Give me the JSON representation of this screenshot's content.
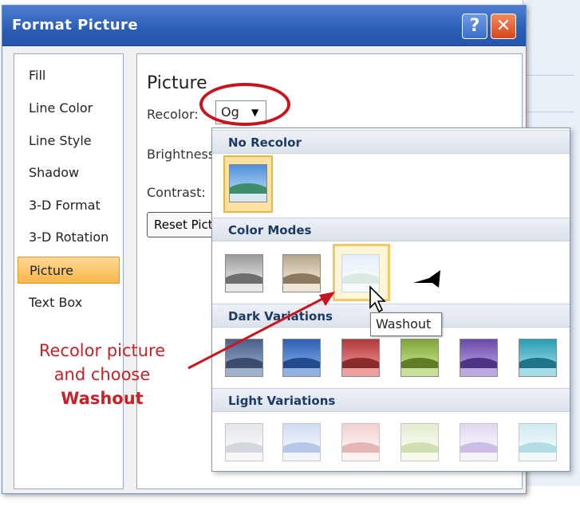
{
  "dialog": {
    "title": "Format Picture",
    "help_label": "?",
    "close_label": "✕"
  },
  "nav": {
    "items": [
      {
        "label": "Fill"
      },
      {
        "label": "Line Color"
      },
      {
        "label": "Line Style"
      },
      {
        "label": "Shadow"
      },
      {
        "label": "3-D Format"
      },
      {
        "label": "3-D Rotation"
      },
      {
        "label": "Picture",
        "selected": true
      },
      {
        "label": "Text Box"
      }
    ]
  },
  "panel": {
    "title": "Picture",
    "recolor_label": "Recolor:",
    "recolor_value": "Og",
    "brightness_label": "Brightness:",
    "contrast_label": "Contrast:",
    "reset_label": "Reset Picture"
  },
  "gallery": {
    "sections": [
      {
        "title": "No Recolor"
      },
      {
        "title": "Color Modes"
      },
      {
        "title": "Dark Variations"
      },
      {
        "title": "Light Variations"
      }
    ],
    "tooltip": "Washout"
  },
  "annotation": {
    "line1": "Recolor picture",
    "line2": "and choose",
    "line3": "Washout",
    "color": "#c62328"
  },
  "colors": {
    "title_bar": "#2a5db5",
    "selected_nav": "#f7b64a",
    "highlight_ring": "#c8141d"
  }
}
